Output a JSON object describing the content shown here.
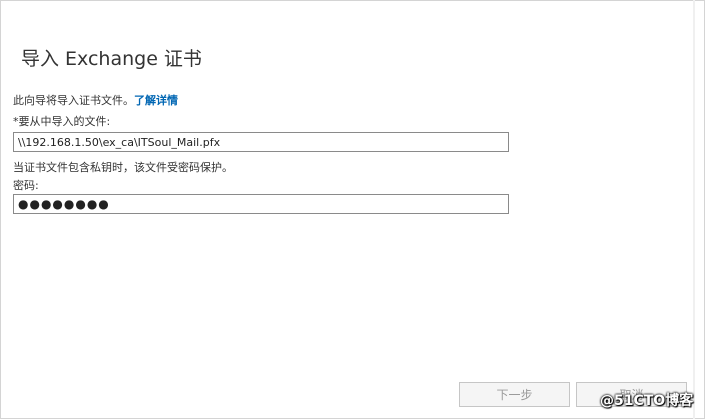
{
  "dialog": {
    "title": "导入 Exchange 证书"
  },
  "intro": {
    "text": "此向导将导入证书文件。",
    "link": "了解详情"
  },
  "file": {
    "label": "*要从中导入的文件:",
    "value": "\\\\192.168.1.50\\ex_ca\\ITSoul_Mail.pfx"
  },
  "hint": "当证书文件包含私钥时，该文件受密码保护。",
  "password": {
    "label": "密码:",
    "value": "●●●●●●●●"
  },
  "buttons": {
    "next": "下一步",
    "cancel": "取消"
  },
  "watermark": "@51CTO博客"
}
